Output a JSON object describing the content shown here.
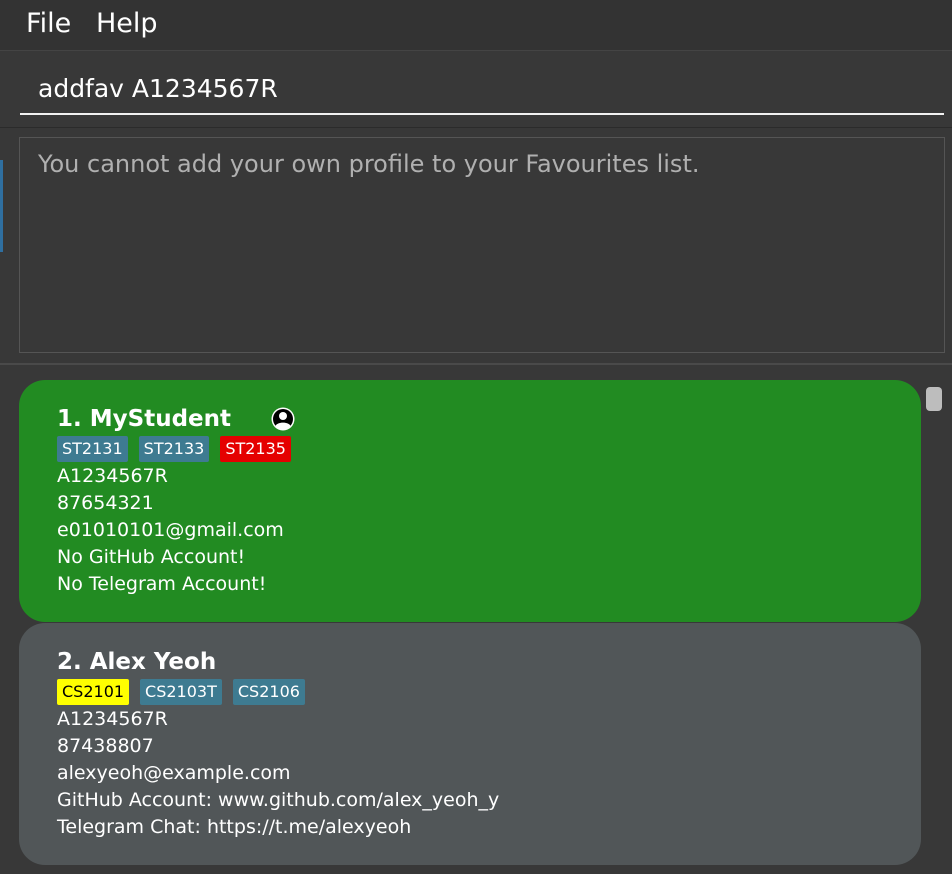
{
  "menu": {
    "file": "File",
    "help": "Help"
  },
  "command": {
    "value": "addfav A1234567R"
  },
  "result": {
    "message": "You cannot add your own profile to your Favourites list."
  },
  "persons": [
    {
      "index": "1.",
      "name": "MyStudent",
      "is_self": true,
      "tags": [
        {
          "label": "ST2131",
          "color": "#3e7b91"
        },
        {
          "label": "ST2133",
          "color": "#3e7b91"
        },
        {
          "label": "ST2135",
          "color": "#e50000"
        }
      ],
      "student_id": "A1234567R",
      "phone": "87654321",
      "email": "e01010101@gmail.com",
      "github": "No GitHub Account!",
      "telegram": "No Telegram Account!",
      "card_color": "#228b22"
    },
    {
      "index": "2.",
      "name": "Alex Yeoh",
      "is_self": false,
      "tags": [
        {
          "label": "CS2101",
          "color": "#ffff00"
        },
        {
          "label": "CS2103T",
          "color": "#3e7b91"
        },
        {
          "label": "CS2106",
          "color": "#3e7b91"
        }
      ],
      "student_id": "A1234567R",
      "phone": "87438807",
      "email": "alexyeoh@example.com",
      "github": "GitHub Account: www.github.com/alex_yeoh_y",
      "telegram": "Telegram Chat: https://t.me/alexyeoh",
      "card_color": "#515658"
    }
  ]
}
